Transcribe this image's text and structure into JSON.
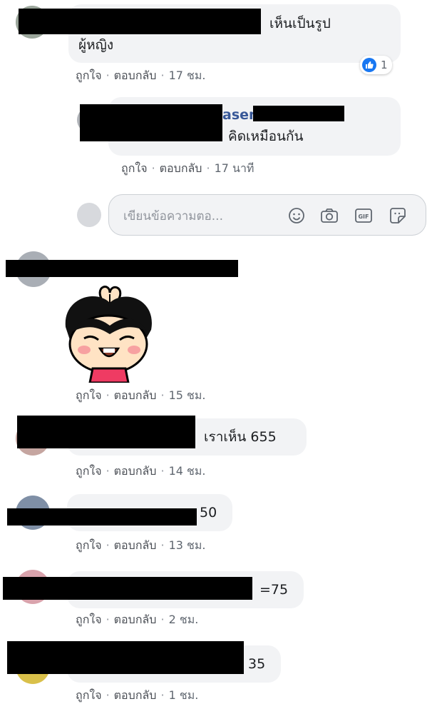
{
  "comments": [
    {
      "text": "เห็นเป็นรูป",
      "text_line2": "ผู้หญิง",
      "like_label": "ถูกใจ",
      "reply_label": "ตอบกลับ",
      "time": "17 ชม.",
      "reaction_count": "1"
    },
    {
      "text": "คิดเหมือนกัน",
      "like_label": "ถูกใจ",
      "reply_label": "ตอบกลับ",
      "time": "17 นาที",
      "name_fragment": "asen"
    },
    {
      "like_label": "ถูกใจ",
      "reply_label": "ตอบกลับ",
      "time": "15 ชม.",
      "sticker": "praying-girl-sticker"
    },
    {
      "text": "เราเห็น 655",
      "like_label": "ถูกใจ",
      "reply_label": "ตอบกลับ",
      "time": "14 ชม."
    },
    {
      "text": "50",
      "like_label": "ถูกใจ",
      "reply_label": "ตอบกลับ",
      "time": "13 ชม."
    },
    {
      "text": "=75",
      "like_label": "ถูกใจ",
      "reply_label": "ตอบกลับ",
      "time": "2 ชม."
    },
    {
      "text": "35",
      "like_label": "ถูกใจ",
      "reply_label": "ตอบกลับ",
      "time": "1 ชม."
    }
  ],
  "reply_input": {
    "placeholder": "เขียนข้อความตอ..."
  },
  "tools": [
    "emoji-icon",
    "camera-icon",
    "gif-icon",
    "sticker-icon"
  ],
  "colors": {
    "link": "#385898",
    "meta": "#606770",
    "bubble": "#f2f3f5",
    "like": "#1877f2"
  }
}
